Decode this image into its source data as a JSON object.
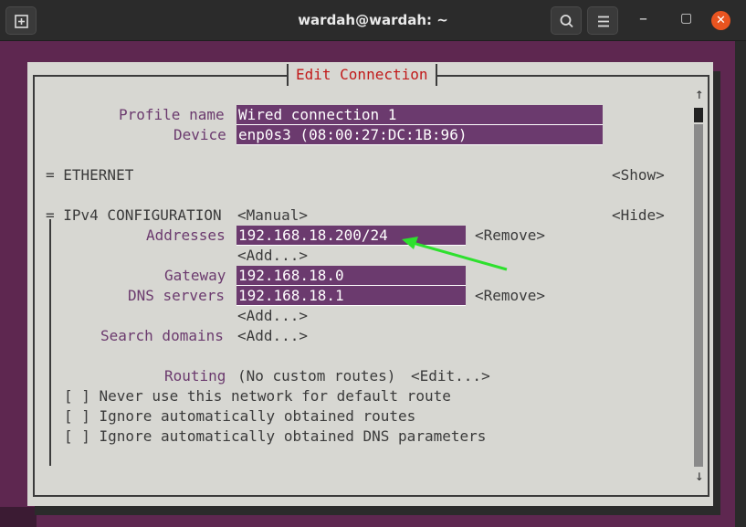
{
  "window": {
    "title": "wardah@wardah: ~",
    "icons": [
      "new-tab-icon",
      "search-icon",
      "hamburger-menu-icon",
      "minimize-icon",
      "maximize-icon",
      "close-icon"
    ]
  },
  "dialog": {
    "title": "Edit Connection",
    "profile": {
      "label": "Profile name",
      "value": "Wired connection 1"
    },
    "device": {
      "label": "Device",
      "value": "enp0s3 (08:00:27:DC:1B:96)"
    },
    "ethernet": {
      "label": "= ETHERNET",
      "action": "<Show>"
    },
    "ipv4": {
      "label": "= IPv4 CONFIGURATION",
      "mode": "<Manual>",
      "action": "<Hide>",
      "addresses_label": "Addresses",
      "address_value": "192.168.18.200/24",
      "address_remove": "<Remove>",
      "address_add": "<Add...>",
      "gateway_label": "Gateway",
      "gateway_value": "192.168.18.0",
      "dns_label": "DNS servers",
      "dns_value": "192.168.18.1",
      "dns_remove": "<Remove>",
      "dns_add": "<Add...>",
      "search_label": "Search domains",
      "search_add": "<Add...>",
      "routing_label": "Routing",
      "routing_value": "(No custom routes)",
      "routing_edit": "<Edit...>",
      "checks": [
        "[ ] Never use this network for default route",
        "[ ] Ignore automatically obtained routes",
        "[ ] Ignore automatically obtained DNS parameters"
      ]
    },
    "scroll": {
      "up": "↑",
      "down": "↓"
    }
  },
  "annotation": {
    "color": "#2ee02e"
  }
}
